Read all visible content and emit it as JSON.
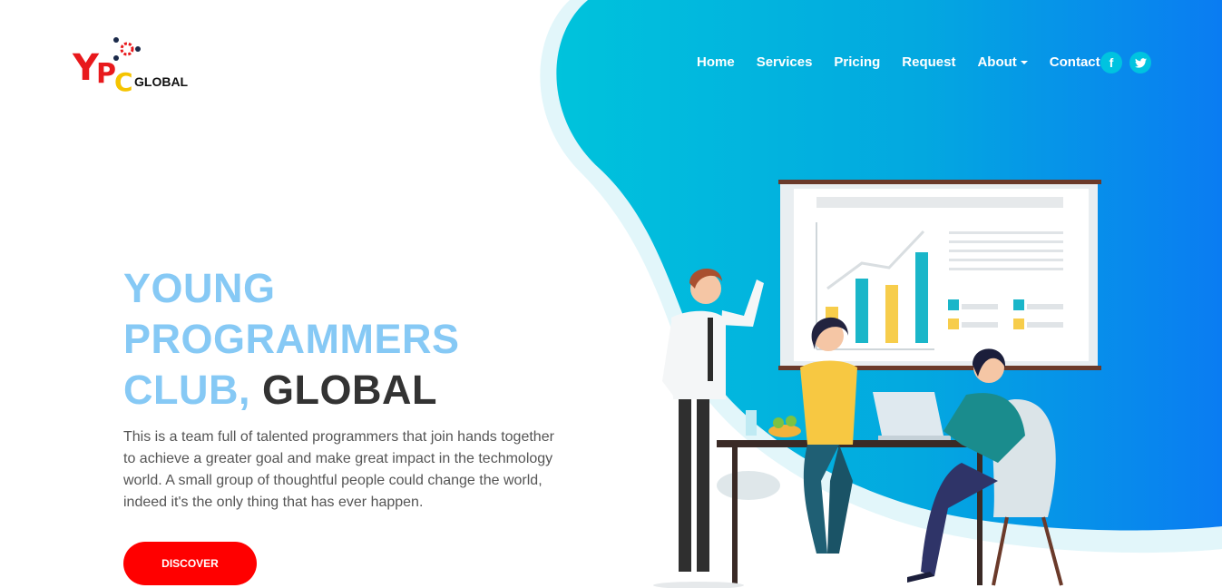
{
  "logo": {
    "y": "Y",
    "p": "P",
    "c": "C",
    "global": "GLOBAL"
  },
  "nav": {
    "home": "Home",
    "services": "Services",
    "pricing": "Pricing",
    "request": "Request",
    "about": "About",
    "contact": "Contact"
  },
  "social": {
    "facebook": "f",
    "twitter": "t"
  },
  "hero": {
    "line1": "YOUNG",
    "line2": "PROGRAMMERS",
    "line3_blue": "CLUB,",
    "line3_dark": "GLOBAL",
    "description": "This is a team full of talented programmers that join hands together to achieve a greater goal and make great impact in the techmology world. A small group of thoughtful people could change the world, indeed it's the only thing that has ever happen.",
    "button": "DISCOVER"
  },
  "colors": {
    "accent": "#00c3e0",
    "gradient_end": "#0a7cf2",
    "title_blue": "#86c9f5",
    "button": "#ff0000"
  }
}
